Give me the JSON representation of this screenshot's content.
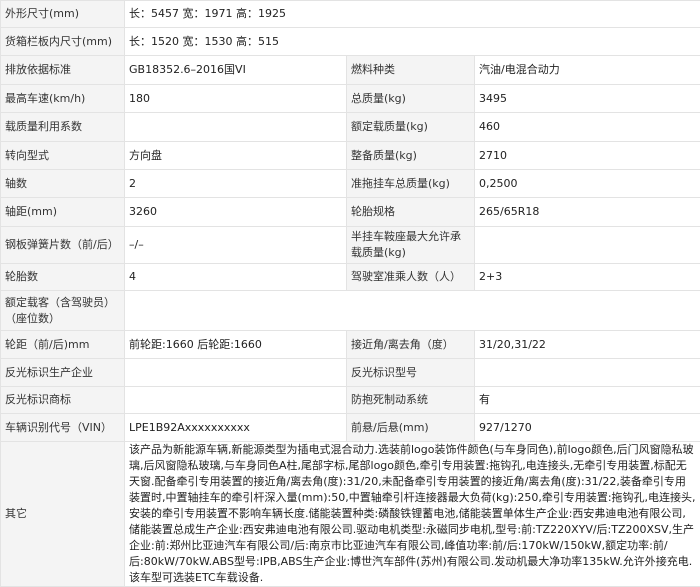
{
  "rows": [
    {
      "label": "外形尺寸(mm)",
      "value": "长：5457 宽：1971 高：1925"
    },
    {
      "label": "货箱栏板内尺寸(mm)",
      "value": "长：1520 宽：1530 高：515"
    },
    {
      "l1": "排放依据标准",
      "v1": "GB18352.6–2016国VI",
      "l2": "燃料种类",
      "v2": "汽油/电混合动力"
    },
    {
      "l1": "最高车速(km/h)",
      "v1": "180",
      "l2": "总质量(kg)",
      "v2": "3495"
    },
    {
      "l1": "载质量利用系数",
      "v1": "",
      "l2": "额定载质量(kg)",
      "v2": "460"
    },
    {
      "l1": "转向型式",
      "v1": "方向盘",
      "l2": "整备质量(kg)",
      "v2": "2710"
    },
    {
      "l1": "轴数",
      "v1": "2",
      "l2": "准拖挂车总质量(kg)",
      "v2": "0,2500"
    },
    {
      "l1": "轴距(mm)",
      "v1": "3260",
      "l2": "轮胎规格",
      "v2": "265/65R18"
    },
    {
      "l1": "钢板弹簧片数（前/后）",
      "v1": "–/–",
      "l2": "半挂车鞍座最大允许承载质量(kg)",
      "v2": ""
    },
    {
      "l1": "轮胎数",
      "v1": "4",
      "l2": "驾驶室准乘人数（人）",
      "v2": "2+3"
    },
    {
      "label": "额定载客（含驾驶员）（座位数）",
      "value": ""
    },
    {
      "l1": "轮距（前/后)mm",
      "v1": "前轮距:1660 后轮距:1660",
      "l2": "接近角/离去角（度）",
      "v2": "31/20,31/22"
    },
    {
      "l1": "反光标识生产企业",
      "v1": "",
      "l2": "反光标识型号",
      "v2": ""
    },
    {
      "l1": "反光标识商标",
      "v1": "",
      "l2": "防抱死制动系统",
      "v2": "有"
    },
    {
      "l1": "车辆识别代号（VIN）",
      "v1": "LPE1B92Axxxxxxxxxx",
      "l2": "前悬/后悬(mm)",
      "v2": "927/1270"
    },
    {
      "label": "其它",
      "value": "该产品为新能源车辆,新能源类型为插电式混合动力.选装前logo装饰件颜色(与车身同色),前logo颜色,后门风窗隐私玻璃,后风窗隐私玻璃,与车身同色A柱,尾部字标,尾部logo颜色,牵引专用装置:拖钩孔,电连接头,无牵引专用装置,标配无天窗.配备牵引专用装置的接近角/离去角(度):31/20,未配备牵引专用装置的接近角/离去角(度):31/22,装备牵引专用装置时,中置轴挂车的牵引杆深入量(mm):50,中置轴牵引杆连接器最大负荷(kg):250,牵引专用装置:拖钩孔,电连接头,安装的牵引专用装置不影响车辆长度.储能装置种类:磷酸铁锂蓄电池,储能装置单体生产企业:西安弗迪电池有限公司,储能装置总成生产企业:西安弗迪电池有限公司.驱动电机类型:永磁同步电机,型号:前:TZ220XYV/后:TZ200XSV,生产企业:前:郑州比亚迪汽车有限公司/后:南京市比亚迪汽车有限公司,峰值功率:前/后:170kW/150kW,额定功率:前/后:80kW/70kW.ABS型号:IPB,ABS生产企业:博世汽车部件(苏州)有限公司.发动机最大净功率135kW.允许外接充电.该车型可选装ETC车载设备."
    }
  ]
}
